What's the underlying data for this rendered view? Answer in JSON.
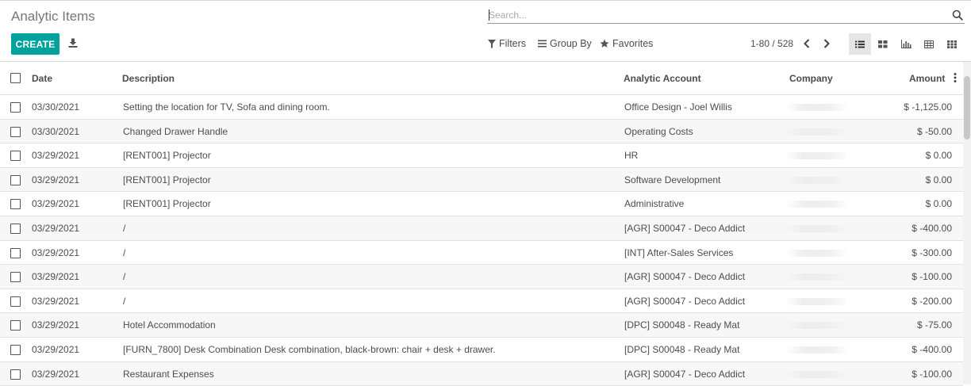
{
  "page": {
    "title": "Analytic Items"
  },
  "search": {
    "placeholder": "Search..."
  },
  "toolbar": {
    "create_label": "CREATE",
    "filters_label": "Filters",
    "group_by_label": "Group By",
    "favorites_label": "Favorites"
  },
  "pager": {
    "value": "1-80 / 528"
  },
  "views": [
    "list",
    "kanban",
    "graph",
    "pivot",
    "grid"
  ],
  "active_view": "list",
  "colors": {
    "accent": "#00a09d"
  },
  "table": {
    "headers": {
      "date": "Date",
      "description": "Description",
      "account": "Analytic Account",
      "company": "Company",
      "amount": "Amount"
    },
    "rows": [
      {
        "date": "03/30/2021",
        "description": "Setting the location for TV, Sofa and dining room.",
        "account": "Office Design - Joel Willis",
        "amount": "$ -1,125.00"
      },
      {
        "date": "03/30/2021",
        "description": "Changed Drawer Handle",
        "account": "Operating Costs",
        "amount": "$ -50.00"
      },
      {
        "date": "03/29/2021",
        "description": "[RENT001] Projector",
        "account": "HR",
        "amount": "$ 0.00"
      },
      {
        "date": "03/29/2021",
        "description": "[RENT001] Projector",
        "account": "Software Development",
        "amount": "$ 0.00"
      },
      {
        "date": "03/29/2021",
        "description": "[RENT001] Projector",
        "account": "Administrative",
        "amount": "$ 0.00"
      },
      {
        "date": "03/29/2021",
        "description": "/",
        "account": "[AGR] S00047 - Deco Addict",
        "amount": "$ -400.00"
      },
      {
        "date": "03/29/2021",
        "description": "/",
        "account": "[INT] After-Sales Services",
        "amount": "$ -300.00"
      },
      {
        "date": "03/29/2021",
        "description": "/",
        "account": "[AGR] S00047 - Deco Addict",
        "amount": "$ -100.00"
      },
      {
        "date": "03/29/2021",
        "description": "/",
        "account": "[AGR] S00047 - Deco Addict",
        "amount": "$ -200.00"
      },
      {
        "date": "03/29/2021",
        "description": "Hotel Accommodation",
        "account": "[DPC] S00048 - Ready Mat",
        "amount": "$ -75.00"
      },
      {
        "date": "03/29/2021",
        "description": "[FURN_7800] Desk Combination Desk combination, black-brown: chair + desk + drawer.",
        "account": "[DPC] S00048 - Ready Mat",
        "amount": "$ -400.00"
      },
      {
        "date": "03/29/2021",
        "description": "Restaurant Expenses",
        "account": "[AGR] S00047 - Deco Addict",
        "amount": "$ -100.00"
      }
    ]
  }
}
